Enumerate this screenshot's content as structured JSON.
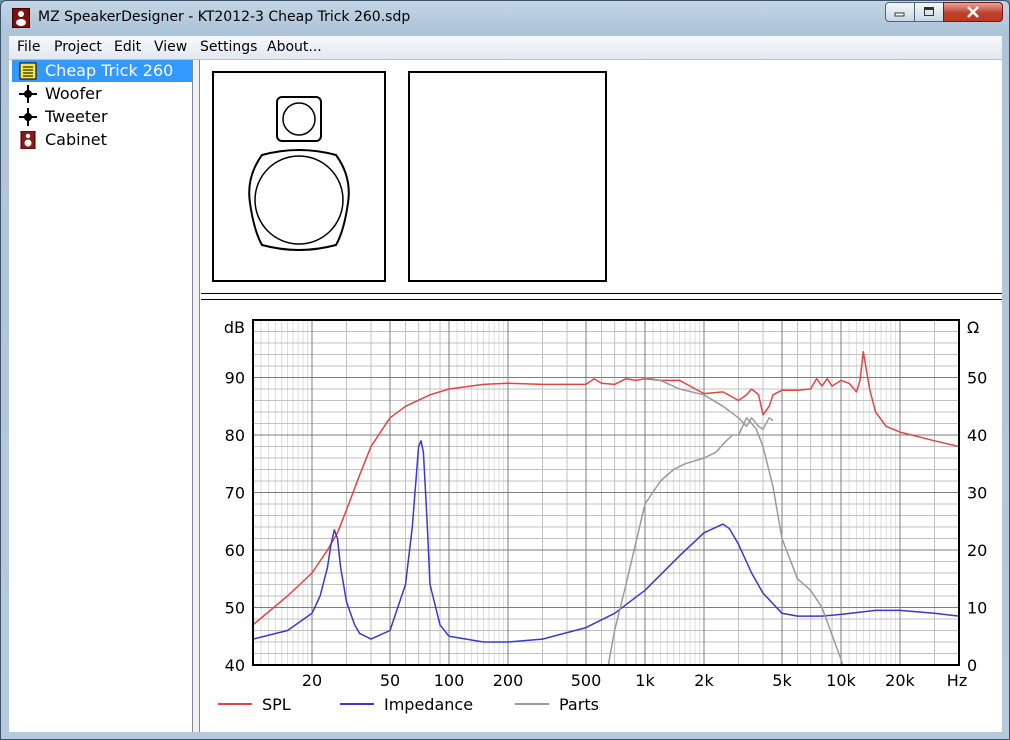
{
  "window": {
    "title": "MZ SpeakerDesigner - KT2012-3 Cheap Trick 260.sdp"
  },
  "menu": [
    "File",
    "Project",
    "Edit",
    "View",
    "Settings",
    "About..."
  ],
  "tree": [
    {
      "label": "Cheap Trick 260",
      "icon": "project-icon",
      "selected": true
    },
    {
      "label": "Woofer",
      "icon": "driver-node-icon",
      "selected": false
    },
    {
      "label": "Tweeter",
      "icon": "driver-node-icon",
      "selected": false
    },
    {
      "label": "Cabinet",
      "icon": "speaker-icon",
      "selected": false
    }
  ],
  "chart_data": {
    "type": "line",
    "x_scale": "log",
    "xlim": [
      10,
      40000
    ],
    "ylim": [
      40,
      100
    ],
    "y2lim": [
      0,
      60
    ],
    "grid": true,
    "legend_position": "bottom",
    "ylabel": "dB",
    "y2label": "Ω",
    "xlabel": "Hz",
    "x_ticks": [
      {
        "label": "20",
        "value": 20
      },
      {
        "label": "50",
        "value": 50
      },
      {
        "label": "100",
        "value": 100
      },
      {
        "label": "200",
        "value": 200
      },
      {
        "label": "500",
        "value": 500
      },
      {
        "label": "1k",
        "value": 1000
      },
      {
        "label": "2k",
        "value": 2000
      },
      {
        "label": "5k",
        "value": 5000
      },
      {
        "label": "10k",
        "value": 10000
      },
      {
        "label": "20k",
        "value": 20000
      }
    ],
    "y_ticks": [
      40,
      50,
      60,
      70,
      80,
      90
    ],
    "y2_ticks": [
      0,
      10,
      20,
      30,
      40,
      50
    ],
    "series": [
      {
        "name": "SPL",
        "axis": "left",
        "color": "#e04545",
        "x": [
          10,
          15,
          20,
          24,
          27,
          30,
          35,
          40,
          50,
          60,
          80,
          100,
          150,
          200,
          300,
          400,
          500,
          550,
          600,
          700,
          800,
          900,
          1000,
          1200,
          1500,
          2000,
          2500,
          3000,
          3300,
          3500,
          3800,
          4000,
          4300,
          4500,
          5000,
          6000,
          7000,
          7500,
          8000,
          8500,
          9000,
          10000,
          11000,
          12000,
          12500,
          13000,
          14000,
          15000,
          17000,
          20000,
          30000,
          40000
        ],
        "y": [
          47,
          52,
          56,
          60,
          63,
          67,
          73,
          78,
          83,
          85,
          87,
          88,
          88.8,
          89,
          88.8,
          88.8,
          88.8,
          89.8,
          89,
          88.8,
          89.8,
          89.5,
          89.8,
          89.5,
          89.5,
          87.2,
          87.5,
          86,
          87,
          88,
          87,
          83.5,
          85,
          87,
          87.8,
          87.8,
          88,
          89.8,
          88.5,
          89.8,
          88.5,
          89.5,
          89,
          87.5,
          89.5,
          94.5,
          88,
          84,
          81.5,
          80.5,
          79,
          78
        ]
      },
      {
        "name": "Impedance",
        "axis": "right",
        "color": "#3a3ac4",
        "x": [
          10,
          15,
          20,
          22,
          24,
          25,
          26,
          27,
          28,
          30,
          33,
          35,
          40,
          50,
          60,
          65,
          70,
          72,
          74,
          77,
          80,
          90,
          100,
          150,
          200,
          300,
          500,
          700,
          1000,
          1500,
          2000,
          2500,
          2700,
          3000,
          3500,
          4000,
          5000,
          6000,
          8000,
          10000,
          15000,
          20000,
          30000,
          40000
        ],
        "y": [
          4.5,
          6,
          9,
          12,
          17,
          21,
          23.5,
          22,
          17,
          11,
          7,
          5.5,
          4.5,
          6,
          14,
          24,
          38,
          39,
          37,
          26,
          14,
          7,
          5,
          4,
          4,
          4.5,
          6.5,
          9,
          13,
          19,
          23,
          24.5,
          23.7,
          21,
          16,
          12.5,
          9,
          8.5,
          8.5,
          8.8,
          9.5,
          9.5,
          9,
          8.5
        ]
      },
      {
        "name": "Parts",
        "axis": "right",
        "color": "#9a9a9a",
        "x": [
          580,
          650,
          700,
          800,
          1000,
          1200,
          1400,
          1600,
          2000,
          2300,
          2600,
          2800,
          3000,
          3300,
          3500,
          3700,
          4000,
          4500,
          5000,
          6000,
          7000,
          8000,
          10000,
          10800
        ],
        "y": [
          -5,
          0,
          6,
          14,
          28,
          32,
          34,
          35,
          36,
          37,
          39,
          40,
          40,
          43,
          42,
          41,
          38,
          31,
          22,
          15,
          13,
          10,
          1,
          -3
        ]
      },
      {
        "name": "Parts",
        "axis": "right",
        "color": "#9a9a9a",
        "x": [
          1000,
          1200,
          1500,
          2000,
          2500,
          3000,
          3300,
          3500,
          3800,
          4000,
          4300,
          4500
        ],
        "y": [
          50,
          49.5,
          48,
          47,
          45,
          43,
          41.5,
          43,
          41.5,
          41,
          43,
          42.5
        ]
      }
    ],
    "legend": [
      {
        "label": "SPL",
        "color": "#e04545"
      },
      {
        "label": "Impedance",
        "color": "#3a3ac4"
      },
      {
        "label": "Parts",
        "color": "#9a9a9a"
      }
    ]
  }
}
